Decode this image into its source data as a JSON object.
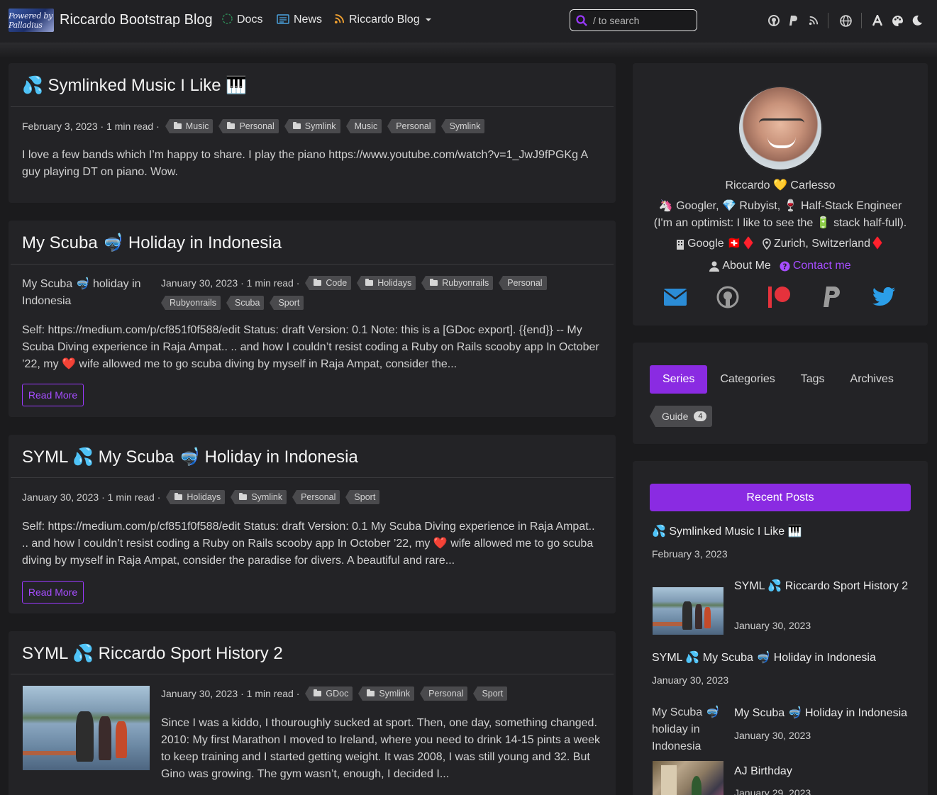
{
  "nav": {
    "brand_logo_text": "Powered by Palladius",
    "brand_title": "Riccardo Bootstrap Blog",
    "links": [
      {
        "icon": "question-circle-icon",
        "label": "Docs"
      },
      {
        "icon": "newspaper-icon",
        "label": "News"
      },
      {
        "icon": "rss-icon",
        "label": "Riccardo Blog"
      }
    ],
    "search_placeholder": "/ to search",
    "right_icons": [
      "github-icon",
      "paypal-icon",
      "rss-icon",
      "globe-icon",
      "font-size-icon",
      "palette-icon",
      "moon-icon"
    ]
  },
  "posts": [
    {
      "title": "💦 Symlinked Music I Like 🎹",
      "date": "February 3, 2023",
      "read_time": "1 min read",
      "categories": [
        "Music",
        "Personal",
        "Symlink"
      ],
      "tags": [
        "Music",
        "Personal",
        "Symlink"
      ],
      "excerpt": "I love a few bands which I’m happy to share. I play the piano https://www.youtube.com/watch?v=1_JwJ9fPGKg A guy playing DT on piano. Wow."
    },
    {
      "title": "My Scuba 🤿 Holiday in Indonesia",
      "image_alt": "My Scuba 🤿 holiday in Indonesia",
      "date": "January 30, 2023",
      "read_time": "1 min read",
      "categories": [
        "Code",
        "Holidays",
        "Rubyonrails"
      ],
      "tags": [
        "Personal",
        "Rubyonrails",
        "Scuba",
        "Sport"
      ],
      "excerpt": "Self: https://medium.com/p/cf851f0f588/edit Status: draft Version: 0.1 Note: this is a [GDoc export]. {{end}} -- My Scuba Diving experience in Raja Ampat.. .. and how I couldn’t resist coding a Ruby on Rails scooby app In October ’22, my ❤️ wife allowed me to go scuba diving by myself in Raja Ampat, consider the...",
      "read_more": "Read More"
    },
    {
      "title": "SYML 💦 My Scuba 🤿 Holiday in Indonesia",
      "date": "January 30, 2023",
      "read_time": "1 min read",
      "categories": [
        "Holidays",
        "Symlink"
      ],
      "tags": [
        "Personal",
        "Sport"
      ],
      "excerpt": "Self: https://medium.com/p/cf851f0f588/edit Status: draft Version: 0.1 My Scuba Diving experience in Raja Ampat.. .. and how I couldn’t resist coding a Ruby on Rails scooby app In October ’22, my ❤️ wife allowed me to go scuba diving by myself in Raja Ampat, consider the paradise for divers. A beautiful and rare...",
      "read_more": "Read More"
    },
    {
      "title": "SYML 💦 Riccardo Sport History 2",
      "date": "January 30, 2023",
      "read_time": "1 min read",
      "categories": [
        "GDoc",
        "Symlink"
      ],
      "tags": [
        "Personal",
        "Sport"
      ],
      "excerpt": "Since I was a kiddo, I thouroughly sucked at sport. Then, one day, something changed. 2010: My first Marathon I moved to Ireland, where you need to drink 14-15 pints a week to keep training and I started getting weight. It was 2008, I was still young and 32. But Gino was growing. The gym wasn’t, enough, I decided I..."
    }
  ],
  "profile": {
    "name_first": "Riccardo",
    "name_emoji": "💛",
    "name_last": "Carlesso",
    "bio_line1": "🦄 Googler, 💎 Rubyist, 🍷 Half-Stack Engineer",
    "bio_line2": "(I'm an optimist: I like to see the 🔋 stack half-full).",
    "company": "Google 🇨🇭♦️",
    "location": "Zurich, Switzerland♦️",
    "about_label": "About Me",
    "contact_label": "Contact me",
    "social_icons": [
      "email-icon",
      "github-icon",
      "patreon-icon",
      "paypal-icon",
      "twitter-icon"
    ]
  },
  "sidebar_tabs": {
    "tabs": [
      "Series",
      "Categories",
      "Tags",
      "Archives"
    ],
    "active": "Series",
    "series": [
      {
        "label": "Guide",
        "count": "4"
      }
    ]
  },
  "recent_posts": {
    "header": "Recent Posts",
    "items": [
      {
        "title": "💦 Symlinked Music I Like 🎹",
        "date": "February 3, 2023"
      },
      {
        "title": "SYML 💦 Riccardo Sport History 2",
        "date": "January 30, 2023"
      },
      {
        "title": "SYML 💦 My Scuba 🤿 Holiday in Indonesia",
        "date": "January 30, 2023"
      },
      {
        "title": "My Scuba 🤿 Holiday in Indonesia",
        "date": "January 30, 2023",
        "image_alt": "My Scuba 🤿 holiday in Indonesia"
      },
      {
        "title": "AJ Birthday",
        "date": "January 29, 2023"
      }
    ]
  },
  "colors": {
    "accent": "#8a2be2",
    "background": "#1b1b1d",
    "card": "#232326",
    "tag": "#4a4a4d"
  }
}
